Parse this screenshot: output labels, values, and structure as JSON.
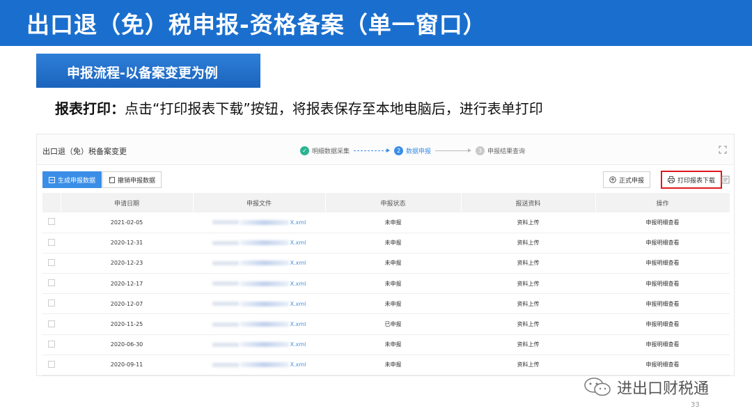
{
  "slide": {
    "title": "出口退（免）税申报-资格备案（单一窗口）",
    "section_label": "申报流程-以备案变更为例",
    "instruction_bold": "报表打印：",
    "instruction_text": "点击“打印报表下载”按钮，将报表保存至本地电脑后，进行表单打印",
    "page_number": "33",
    "watermark": "进出口财税通"
  },
  "app": {
    "title": "出口退（免）税备案变更",
    "steps": [
      {
        "label": "明细数据采集",
        "status": "done",
        "mark": "✓"
      },
      {
        "label": "数据申报",
        "status": "active",
        "mark": "2"
      },
      {
        "label": "申报结果查询",
        "status": "todo",
        "mark": "3"
      }
    ],
    "toolbar": {
      "generate_label": "生成申报数据",
      "cancel_label": "撤销申报数据",
      "submit_label": "正式申报",
      "print_label": "打印报表下载"
    },
    "table": {
      "headers": [
        "申请日期",
        "申报文件",
        "申报状态",
        "报送资料",
        "操作"
      ],
      "rows": [
        {
          "date": "2021-02-05",
          "file_ext": "X.xml",
          "status": "未申报",
          "upload": "资料上传",
          "action": "申报明细查看"
        },
        {
          "date": "2020-12-31",
          "file_ext": "X.xml",
          "status": "未申报",
          "upload": "资料上传",
          "action": "申报明细查看"
        },
        {
          "date": "2020-12-23",
          "file_ext": "X.xml",
          "status": "未申报",
          "upload": "资料上传",
          "action": "申报明细查看"
        },
        {
          "date": "2020-12-17",
          "file_ext": "X.xml",
          "status": "未申报",
          "upload": "资料上传",
          "action": "申报明细查看"
        },
        {
          "date": "2020-12-07",
          "file_ext": "X.xml",
          "status": "未申报",
          "upload": "资料上传",
          "action": "申报明细查看"
        },
        {
          "date": "2020-11-25",
          "file_ext": "X.xml",
          "status": "已申报",
          "upload": "资料上传",
          "action": "申报明细查看"
        },
        {
          "date": "2020-06-30",
          "file_ext": "X.xml",
          "status": "未申报",
          "upload": "资料上传",
          "action": "申报明细查看"
        },
        {
          "date": "2020-09-11",
          "file_ext": "X.xml",
          "status": "未申报",
          "upload": "资料上传",
          "action": "申报明细查看"
        }
      ]
    }
  },
  "colors": {
    "title_bar": "#1a6fce",
    "primary": "#3a8ee6",
    "highlight": "#e0171c",
    "done": "#2bb48f"
  }
}
